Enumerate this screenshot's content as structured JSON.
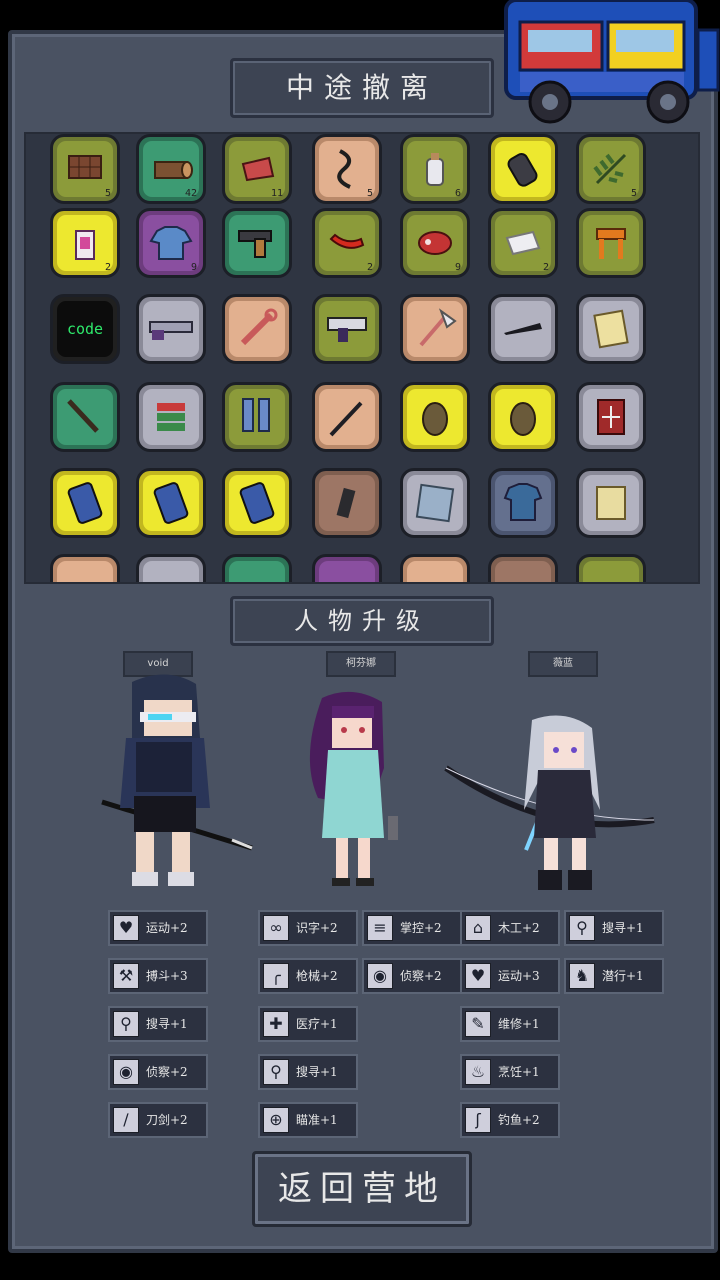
{
  "header": {
    "title": "中途撤离"
  },
  "inventory": {
    "rows": [
      [
        {
          "name": "chocolate",
          "color": "olive",
          "count": "5"
        },
        {
          "name": "log",
          "color": "green",
          "count": "42"
        },
        {
          "name": "raw-meat",
          "color": "olive",
          "count": "11"
        },
        {
          "name": "rope",
          "color": "peach",
          "count": "5"
        },
        {
          "name": "salt-bottle",
          "color": "olive",
          "count": "6"
        },
        {
          "name": "grenade",
          "color": "yellow",
          "count": ""
        },
        {
          "name": "herb",
          "color": "olive",
          "count": "5"
        }
      ],
      [
        {
          "name": "first-aid-kit",
          "color": "yellow",
          "count": "2"
        },
        {
          "name": "blue-shirt",
          "color": "purple",
          "count": "9"
        },
        {
          "name": "pistol",
          "color": "green",
          "count": ""
        },
        {
          "name": "chili-pepper",
          "color": "olive",
          "count": "2"
        },
        {
          "name": "steak",
          "color": "olive",
          "count": "9"
        },
        {
          "name": "cloth",
          "color": "olive",
          "count": "2"
        },
        {
          "name": "wooden-stool",
          "color": "olive",
          "count": ""
        }
      ],
      [
        {
          "name": "code-book",
          "color": "dark",
          "count": "",
          "label": "code"
        },
        {
          "name": "shotgun",
          "color": "grey",
          "count": ""
        },
        {
          "name": "wrench-bone",
          "color": "peach",
          "count": ""
        },
        {
          "name": "uzi",
          "color": "olive",
          "count": ""
        },
        {
          "name": "axe",
          "color": "peach",
          "count": ""
        },
        {
          "name": "knife-blade",
          "color": "grey",
          "count": ""
        },
        {
          "name": "recipe-card",
          "color": "grey",
          "count": ""
        }
      ],
      [
        {
          "name": "crowbar",
          "color": "green",
          "count": ""
        },
        {
          "name": "books",
          "color": "grey",
          "count": ""
        },
        {
          "name": "boots",
          "color": "olive",
          "count": ""
        },
        {
          "name": "hook-stick",
          "color": "peach",
          "count": ""
        },
        {
          "name": "pinecone-grenade",
          "color": "yellow",
          "count": ""
        },
        {
          "name": "pinecone-grenade",
          "color": "yellow",
          "count": ""
        },
        {
          "name": "red-manual",
          "color": "grey",
          "count": ""
        }
      ],
      [
        {
          "name": "battery",
          "color": "yellow",
          "count": ""
        },
        {
          "name": "battery",
          "color": "yellow",
          "count": ""
        },
        {
          "name": "battery",
          "color": "yellow",
          "count": ""
        },
        {
          "name": "magazine",
          "color": "brown",
          "count": ""
        },
        {
          "name": "scissors-card",
          "color": "grey",
          "count": ""
        },
        {
          "name": "armor-vest",
          "color": "slate",
          "count": ""
        },
        {
          "name": "tool-card",
          "color": "grey",
          "count": ""
        }
      ],
      [
        {
          "name": "item",
          "color": "peach",
          "count": ""
        },
        {
          "name": "item",
          "color": "grey",
          "count": ""
        },
        {
          "name": "item",
          "color": "green",
          "count": ""
        },
        {
          "name": "item",
          "color": "purple",
          "count": ""
        },
        {
          "name": "item",
          "color": "peach",
          "count": ""
        },
        {
          "name": "item",
          "color": "brown",
          "count": ""
        },
        {
          "name": "item",
          "color": "olive",
          "count": ""
        }
      ]
    ]
  },
  "upgrade": {
    "title": "人物升级"
  },
  "characters": [
    {
      "name": "void"
    },
    {
      "name": "柯芬娜"
    },
    {
      "name": "薇蓝"
    }
  ],
  "skills": {
    "void": [
      {
        "icon": "heart-icon",
        "label": "运动+2"
      },
      {
        "icon": "axe-icon",
        "label": "搏斗+3"
      },
      {
        "icon": "magnifier-icon",
        "label": "搜寻+1"
      },
      {
        "icon": "eye-icon",
        "label": "侦察+2"
      },
      {
        "icon": "blade-icon",
        "label": "刀剑+2"
      }
    ],
    "kefenna": [
      {
        "icon": "glasses-icon",
        "label": "识字+2"
      },
      {
        "icon": "pistol-icon",
        "label": "枪械+2"
      },
      {
        "icon": "medkit-icon",
        "label": "医疗+1"
      },
      {
        "icon": "magnifier-icon",
        "label": "搜寻+1"
      },
      {
        "icon": "target-icon",
        "label": "瞄准+1"
      }
    ],
    "kefenna_extra": [
      {
        "icon": "claw-icon",
        "label": "掌控+2"
      },
      {
        "icon": "eye-icon",
        "label": "侦察+2"
      }
    ],
    "weilan": [
      {
        "icon": "house-icon",
        "label": "木工+2"
      },
      {
        "icon": "heart-icon",
        "label": "运动+3"
      },
      {
        "icon": "wrench-icon",
        "label": "维修+1"
      },
      {
        "icon": "cooking-icon",
        "label": "烹饪+1"
      },
      {
        "icon": "fishing-icon",
        "label": "钓鱼+2"
      }
    ],
    "weilan_extra": [
      {
        "icon": "magnifier-icon",
        "label": "搜寻+1"
      },
      {
        "icon": "dog-icon",
        "label": "潜行+1"
      }
    ]
  },
  "buttons": {
    "return": "返回营地"
  }
}
